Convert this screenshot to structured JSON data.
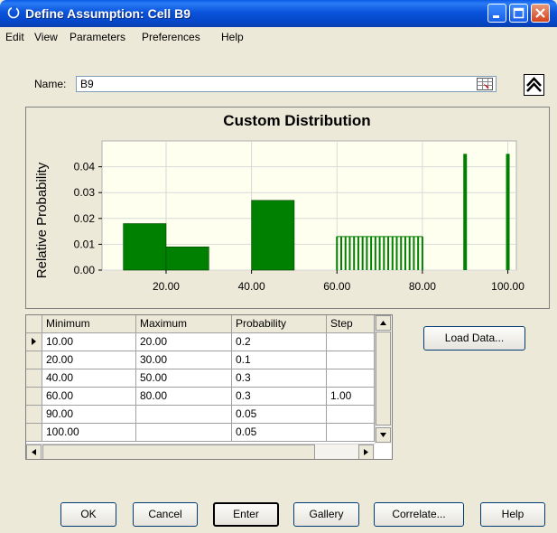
{
  "window": {
    "title": "Define Assumption: Cell B9"
  },
  "menu": [
    "Edit",
    "View",
    "Parameters",
    "Preferences",
    "Help"
  ],
  "name_field": {
    "label": "Name:",
    "value": "B9"
  },
  "chart_data": {
    "type": "bar",
    "title": "Custom Distribution",
    "ylabel": "Relative Probability",
    "xlabel": "",
    "xlim": [
      5,
      102
    ],
    "ylim": [
      0,
      0.05
    ],
    "x_ticks": [
      "20.00",
      "40.00",
      "60.00",
      "80.00",
      "100.00"
    ],
    "x_tick_values": [
      20,
      40,
      60,
      80,
      100
    ],
    "y_ticks": [
      "0.00",
      "0.01",
      "0.02",
      "0.03",
      "0.04"
    ],
    "y_tick_values": [
      0,
      0.01,
      0.02,
      0.03,
      0.04
    ],
    "ranges": [
      {
        "min": 10,
        "max": 20,
        "value": 0.018
      },
      {
        "min": 20,
        "max": 30,
        "value": 0.009
      },
      {
        "min": 40,
        "max": 50,
        "value": 0.027
      }
    ],
    "stepped": {
      "min": 60,
      "max": 80,
      "step": 1,
      "value": 0.013
    },
    "discrete": [
      {
        "x": 90,
        "value": 0.045
      },
      {
        "x": 100,
        "value": 0.045
      }
    ],
    "colors": {
      "bar": "#008000",
      "plot_bg": "#fffff0",
      "grid": "#d8d8d8"
    }
  },
  "table": {
    "headers": [
      "Minimum",
      "Maximum",
      "Probability",
      "Step"
    ],
    "rows": [
      [
        "10.00",
        "20.00",
        "0.2",
        ""
      ],
      [
        "20.00",
        "30.00",
        "0.1",
        ""
      ],
      [
        "40.00",
        "50.00",
        "0.3",
        ""
      ],
      [
        "60.00",
        "80.00",
        "0.3",
        "1.00"
      ],
      [
        "90.00",
        "",
        "0.05",
        ""
      ],
      [
        "100.00",
        "",
        "0.05",
        ""
      ]
    ]
  },
  "buttons": {
    "load_data": "Load Data...",
    "ok": "OK",
    "cancel": "Cancel",
    "enter": "Enter",
    "gallery": "Gallery",
    "correlate": "Correlate...",
    "help": "Help"
  }
}
